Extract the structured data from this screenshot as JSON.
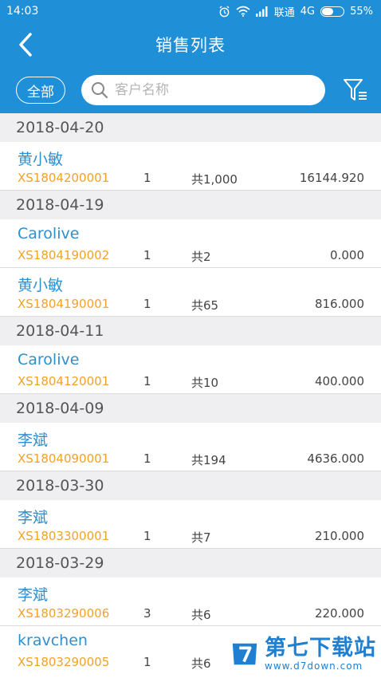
{
  "status_bar": {
    "time": "14:03",
    "carrier": "联通",
    "network": "4G",
    "battery": "55%",
    "battery_level": 0.55
  },
  "header": {
    "title": "销售列表",
    "all_label": "全部",
    "search_placeholder": "客户名称"
  },
  "groups": [
    {
      "date": "2018-04-20",
      "items": [
        {
          "customer": "黄小敏",
          "order": "XS1804200001",
          "count": "1",
          "qty": "共1,000",
          "amount": "16144.920"
        }
      ]
    },
    {
      "date": "2018-04-19",
      "items": [
        {
          "customer": "Carolive",
          "order": "XS1804190002",
          "count": "1",
          "qty": "共2",
          "amount": "0.000"
        },
        {
          "customer": "黄小敏",
          "order": "XS1804190001",
          "count": "1",
          "qty": "共65",
          "amount": "816.000"
        }
      ]
    },
    {
      "date": "2018-04-11",
      "items": [
        {
          "customer": "Carolive",
          "order": "XS1804120001",
          "count": "1",
          "qty": "共10",
          "amount": "400.000"
        }
      ]
    },
    {
      "date": "2018-04-09",
      "items": [
        {
          "customer": "李斌",
          "order": "XS1804090001",
          "count": "1",
          "qty": "共194",
          "amount": "4636.000"
        }
      ]
    },
    {
      "date": "2018-03-30",
      "items": [
        {
          "customer": "李斌",
          "order": "XS1803300001",
          "count": "1",
          "qty": "共7",
          "amount": "210.000"
        }
      ]
    },
    {
      "date": "2018-03-29",
      "items": [
        {
          "customer": "李斌",
          "order": "XS1803290006",
          "count": "3",
          "qty": "共6",
          "amount": "220.000"
        },
        {
          "customer": "kravchen",
          "order": "XS1803290005",
          "count": "1",
          "qty": "共6",
          "amount": ""
        }
      ]
    }
  ],
  "watermark": {
    "brand": "第七下载站",
    "url": "www.d7down.com"
  },
  "colors": {
    "primary": "#1f8fd8",
    "customer_text": "#2e8fcf",
    "order_text": "#f0a22b",
    "date_bg": "#efeff1"
  }
}
